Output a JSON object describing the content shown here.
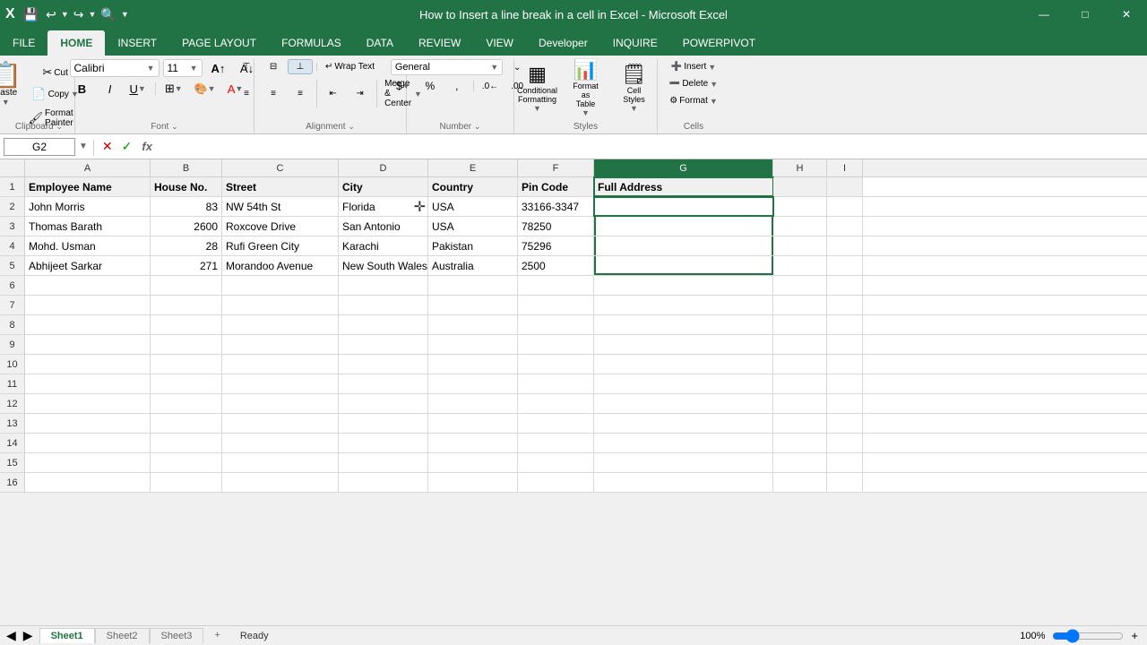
{
  "titleBar": {
    "title": "How to Insert a line break in a cell in Excel - Microsoft Excel",
    "appIcon": "X",
    "winControls": [
      "—",
      "□",
      "✕"
    ]
  },
  "quickAccess": {
    "buttons": [
      "💾",
      "↩",
      "↪",
      "🔍"
    ]
  },
  "ribbonTabs": {
    "tabs": [
      "FILE",
      "HOME",
      "INSERT",
      "PAGE LAYOUT",
      "FORMULAS",
      "DATA",
      "REVIEW",
      "VIEW",
      "Developer",
      "INQUIRE",
      "POWERPIVOT"
    ],
    "active": "HOME"
  },
  "ribbon": {
    "groups": [
      {
        "name": "Clipboard",
        "label": "Clipboard",
        "items": [
          "Paste",
          "Cut",
          "Copy",
          "Format Painter"
        ]
      },
      {
        "name": "Font",
        "label": "Font",
        "fontName": "Calibri",
        "fontSize": "11",
        "items": [
          "Bold",
          "Italic",
          "Underline",
          "Border",
          "Fill Color",
          "Font Color"
        ]
      },
      {
        "name": "Alignment",
        "label": "Alignment",
        "items": [
          "Align Top",
          "Align Middle",
          "Align Bottom",
          "Wrap Text",
          "Merge & Center"
        ]
      },
      {
        "name": "Number",
        "label": "Number",
        "format": "General",
        "items": [
          "Currency",
          "Percent",
          "Comma"
        ]
      },
      {
        "name": "Styles",
        "label": "Styles",
        "items": [
          "Conditional Formatting",
          "Format as Table",
          "Cell Styles"
        ]
      },
      {
        "name": "Cells",
        "label": "Cells",
        "items": [
          "Insert",
          "Delete",
          "Format"
        ]
      }
    ]
  },
  "formulaBar": {
    "nameBox": "G2",
    "cancelBtn": "✕",
    "confirmBtn": "✓",
    "functionBtn": "fx",
    "value": ""
  },
  "columns": {
    "headers": [
      "A",
      "B",
      "C",
      "D",
      "E",
      "F",
      "G",
      "H",
      "I"
    ],
    "widths": [
      140,
      80,
      130,
      100,
      100,
      85,
      200,
      60,
      40
    ],
    "selectedCol": "G"
  },
  "rows": [
    {
      "num": 1,
      "cells": [
        {
          "col": "A",
          "value": "Employee Name",
          "type": "header"
        },
        {
          "col": "B",
          "value": "House No.",
          "type": "header"
        },
        {
          "col": "C",
          "value": "Street",
          "type": "header"
        },
        {
          "col": "D",
          "value": "City",
          "type": "header"
        },
        {
          "col": "E",
          "value": "Country",
          "type": "header"
        },
        {
          "col": "F",
          "value": "Pin Code",
          "type": "header"
        },
        {
          "col": "G",
          "value": "Full Address",
          "type": "header"
        },
        {
          "col": "H",
          "value": "",
          "type": "empty"
        },
        {
          "col": "I",
          "value": "",
          "type": "empty"
        }
      ]
    },
    {
      "num": 2,
      "cells": [
        {
          "col": "A",
          "value": "John Morris",
          "type": "text"
        },
        {
          "col": "B",
          "value": "83",
          "type": "num"
        },
        {
          "col": "C",
          "value": "NW 54th St",
          "type": "text"
        },
        {
          "col": "D",
          "value": "Florida",
          "type": "text"
        },
        {
          "col": "E",
          "value": "USA",
          "type": "text"
        },
        {
          "col": "F",
          "value": "33166-3347",
          "type": "text"
        },
        {
          "col": "G",
          "value": "",
          "type": "active"
        },
        {
          "col": "H",
          "value": "",
          "type": "empty"
        },
        {
          "col": "I",
          "value": "",
          "type": "empty"
        }
      ]
    },
    {
      "num": 3,
      "cells": [
        {
          "col": "A",
          "value": "Thomas Barath",
          "type": "text"
        },
        {
          "col": "B",
          "value": "2600",
          "type": "num"
        },
        {
          "col": "C",
          "value": "Roxcove Drive",
          "type": "text"
        },
        {
          "col": "D",
          "value": "San Antonio",
          "type": "text"
        },
        {
          "col": "E",
          "value": "USA",
          "type": "text"
        },
        {
          "col": "F",
          "value": "78250",
          "type": "text"
        },
        {
          "col": "G",
          "value": "",
          "type": "g-empty"
        },
        {
          "col": "H",
          "value": "",
          "type": "empty"
        },
        {
          "col": "I",
          "value": "",
          "type": "empty"
        }
      ]
    },
    {
      "num": 4,
      "cells": [
        {
          "col": "A",
          "value": "Mohd. Usman",
          "type": "text"
        },
        {
          "col": "B",
          "value": "28",
          "type": "num"
        },
        {
          "col": "C",
          "value": "Rufi Green City",
          "type": "text"
        },
        {
          "col": "D",
          "value": "Karachi",
          "type": "text"
        },
        {
          "col": "E",
          "value": "Pakistan",
          "type": "text"
        },
        {
          "col": "F",
          "value": "75296",
          "type": "text"
        },
        {
          "col": "G",
          "value": "",
          "type": "g-empty"
        },
        {
          "col": "H",
          "value": "",
          "type": "empty"
        },
        {
          "col": "I",
          "value": "",
          "type": "empty"
        }
      ]
    },
    {
      "num": 5,
      "cells": [
        {
          "col": "A",
          "value": "Abhijeet Sarkar",
          "type": "text"
        },
        {
          "col": "B",
          "value": "271",
          "type": "num"
        },
        {
          "col": "C",
          "value": "Morandoo Avenue",
          "type": "text"
        },
        {
          "col": "D",
          "value": "New South Wales",
          "type": "text"
        },
        {
          "col": "E",
          "value": "Australia",
          "type": "text"
        },
        {
          "col": "F",
          "value": "2500",
          "type": "text"
        },
        {
          "col": "G",
          "value": "",
          "type": "g-empty"
        },
        {
          "col": "H",
          "value": "",
          "type": "empty"
        },
        {
          "col": "I",
          "value": "",
          "type": "empty"
        }
      ]
    },
    {
      "num": 6,
      "empty": true
    },
    {
      "num": 7,
      "empty": true
    },
    {
      "num": 8,
      "empty": true
    },
    {
      "num": 9,
      "empty": true
    },
    {
      "num": 10,
      "empty": true
    },
    {
      "num": 11,
      "empty": true
    },
    {
      "num": 12,
      "empty": true
    },
    {
      "num": 13,
      "empty": true
    },
    {
      "num": 14,
      "empty": true
    },
    {
      "num": 15,
      "empty": true
    },
    {
      "num": 16,
      "empty": true
    }
  ],
  "sheetTabs": [
    "Sheet1",
    "Sheet2",
    "Sheet3"
  ],
  "activeSheet": "Sheet1",
  "statusBar": {
    "left": "Ready",
    "zoom": "100%"
  }
}
